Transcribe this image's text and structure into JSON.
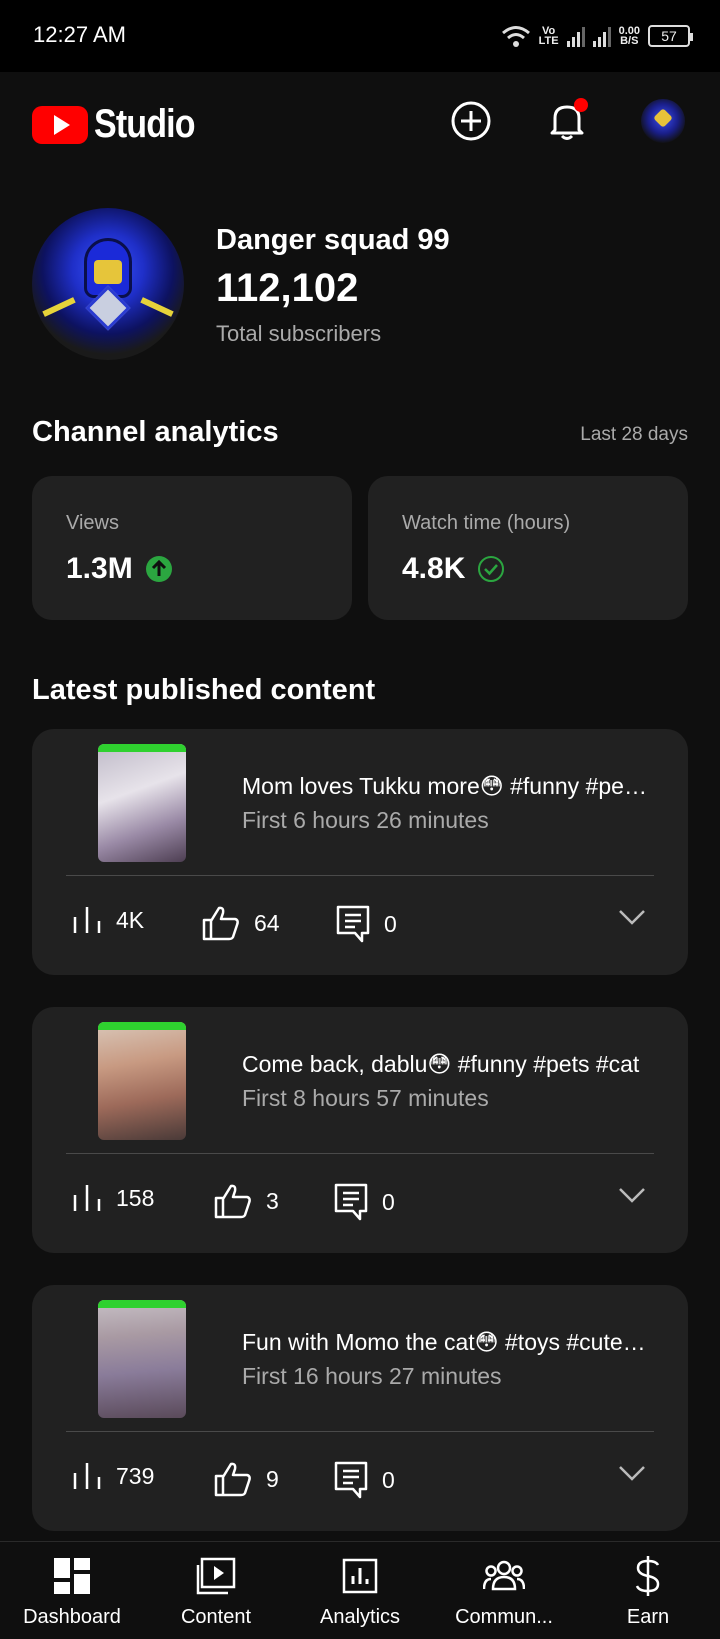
{
  "status_bar": {
    "time": "12:27 AM",
    "net_top": "Vo",
    "net_bottom": "LTE",
    "speed_top": "0.00",
    "speed_bottom": "B/S",
    "battery": "57"
  },
  "app_bar": {
    "logo_text": "Studio",
    "icons": [
      "create-plus-icon",
      "notification-bell-icon",
      "account-avatar"
    ],
    "notification_dot_color": "#ff0000"
  },
  "channel": {
    "name": "Danger squad 99",
    "subscribers": "112,102",
    "subscribers_label": "Total subscribers"
  },
  "analytics": {
    "title": "Channel analytics",
    "period": "Last 28 days",
    "cards": [
      {
        "label": "Views",
        "value": "1.3M",
        "icon": "arrow-up-circle-icon",
        "icon_color": "#2ba640"
      },
      {
        "label": "Watch time (hours)",
        "value": "4.8K",
        "icon": "check-circle-icon",
        "icon_color": "#2ba640"
      }
    ]
  },
  "latest": {
    "title": "Latest published content",
    "videos": [
      {
        "title": "Mom loves Tukku more😳 #funny #pets #dog",
        "subtitle": "First 6 hours 26 minutes",
        "views": "4K",
        "likes": "64",
        "comments": "0"
      },
      {
        "title": "Come back, dablu😳 #funny #pets #cat",
        "subtitle": "First 8 hours 57 minutes",
        "views": "158",
        "likes": "3",
        "comments": "0"
      },
      {
        "title": "Fun with Momo the cat😳 #toys #cute #cat",
        "subtitle": "First 16 hours 27 minutes",
        "views": "739",
        "likes": "9",
        "comments": "0"
      }
    ]
  },
  "bottom_nav": {
    "items": [
      {
        "label": "Dashboard",
        "icon": "dashboard-icon",
        "active": true
      },
      {
        "label": "Content",
        "icon": "content-icon"
      },
      {
        "label": "Analytics",
        "icon": "analytics-icon"
      },
      {
        "label": "Commun...",
        "icon": "community-icon"
      },
      {
        "label": "Earn",
        "icon": "dollar-icon"
      }
    ]
  }
}
